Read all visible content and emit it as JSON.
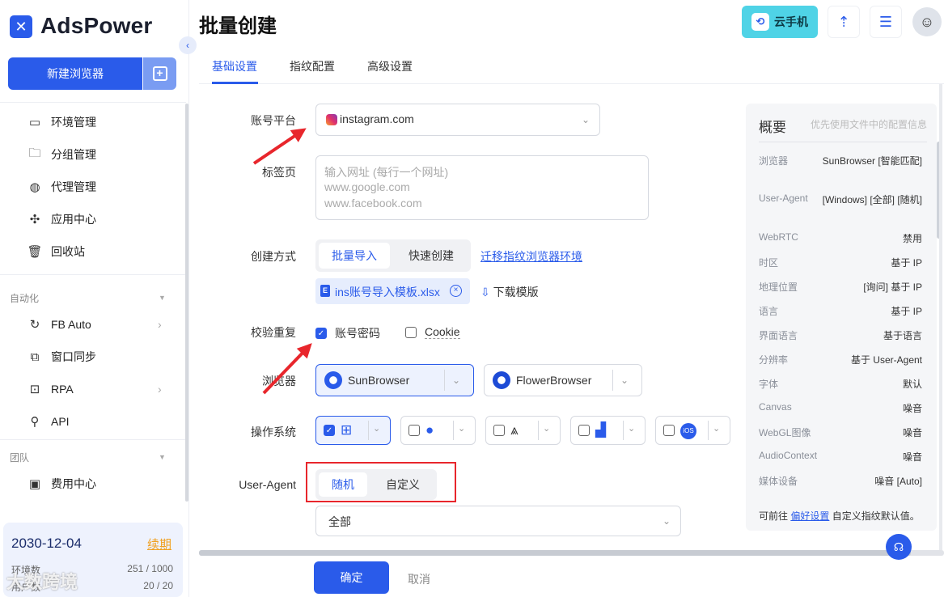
{
  "app": {
    "name": "AdsPower"
  },
  "sidebar": {
    "new_browser": "新建浏览器",
    "items": [
      {
        "label": "环境管理",
        "icon": "browser-window-icon"
      },
      {
        "label": "分组管理",
        "icon": "folder-icon"
      },
      {
        "label": "代理管理",
        "icon": "globe-icon"
      },
      {
        "label": "应用中心",
        "icon": "puzzle-icon"
      },
      {
        "label": "回收站",
        "icon": "trash-icon"
      }
    ],
    "section_auto": "自动化",
    "auto_items": [
      {
        "label": "FB Auto",
        "icon": "refresh-icon",
        "chevron": "›"
      },
      {
        "label": "窗口同步",
        "icon": "sync-icon"
      },
      {
        "label": "RPA",
        "icon": "robot-icon",
        "chevron": "›"
      },
      {
        "label": "API",
        "icon": "api-icon"
      }
    ],
    "section_team": "团队",
    "team_items": [
      {
        "label": "费用中心",
        "icon": "wallet-icon"
      }
    ],
    "expire_date": "2030-12-04",
    "renew": "续期",
    "stats": [
      {
        "label": "环境数",
        "value": "251 / 1000"
      },
      {
        "label": "用户数",
        "value": "20 / 20"
      }
    ]
  },
  "header": {
    "title": "批量创建",
    "cloud_phone": "云手机"
  },
  "tabs": [
    "基础设置",
    "指纹配置",
    "高级设置"
  ],
  "form": {
    "platform_label": "账号平台",
    "platform_value": "instagram.com",
    "tabs_label": "标签页",
    "tabs_placeholder": [
      "输入网址 (每行一个网址)",
      "www.google.com",
      "www.facebook.com"
    ],
    "method_label": "创建方式",
    "method_options": [
      "批量导入",
      "快速创建"
    ],
    "migrate_link": "迁移指纹浏览器环境",
    "file_name": "ins账号导入模板.xlsx",
    "download_template": "下载模版",
    "dedupe_label": "校验重复",
    "dedupe_options": [
      {
        "label": "账号密码",
        "checked": true
      },
      {
        "label": "Cookie",
        "checked": false
      }
    ],
    "browser_label": "浏览器",
    "browsers": [
      "SunBrowser",
      "FlowerBrowser"
    ],
    "os_label": "操作系统",
    "os_options": [
      {
        "name": "windows-icon",
        "checked": true
      },
      {
        "name": "apple-icon",
        "checked": false
      },
      {
        "name": "linux-icon",
        "checked": false
      },
      {
        "name": "android-icon",
        "checked": false
      },
      {
        "name": "ios-icon",
        "checked": false
      }
    ],
    "ua_label": "User-Agent",
    "ua_options": [
      "随机",
      "自定义"
    ],
    "ua_select": "全部"
  },
  "summary": {
    "title": "概要",
    "hint": "优先使用文件中的配置信息",
    "rows": [
      {
        "k": "浏览器",
        "v": "SunBrowser [智能匹配]"
      },
      {
        "k": "User-Agent",
        "v": "[Windows] [全部] [随机]"
      },
      {
        "k": "WebRTC",
        "v": "禁用"
      },
      {
        "k": "时区",
        "v": "基于 IP"
      },
      {
        "k": "地理位置",
        "v": "[询问] 基于 IP"
      },
      {
        "k": "语言",
        "v": "基于 IP"
      },
      {
        "k": "界面语言",
        "v": "基于语言"
      },
      {
        "k": "分辨率",
        "v": "基于 User-Agent"
      },
      {
        "k": "字体",
        "v": "默认"
      },
      {
        "k": "Canvas",
        "v": "噪音"
      },
      {
        "k": "WebGL图像",
        "v": "噪音"
      },
      {
        "k": "AudioContext",
        "v": "噪音"
      },
      {
        "k": "媒体设备",
        "v": "噪音 [Auto]"
      }
    ],
    "foot_pre": "可前往",
    "foot_link": "偏好设置",
    "foot_post": "自定义指纹默认值。"
  },
  "footer": {
    "ok": "确定",
    "cancel": "取消"
  },
  "watermark": "大数跨境",
  "colors": {
    "accent": "#2a5bea",
    "annotation": "#e8262c",
    "cloud": "#4fd3e6"
  }
}
